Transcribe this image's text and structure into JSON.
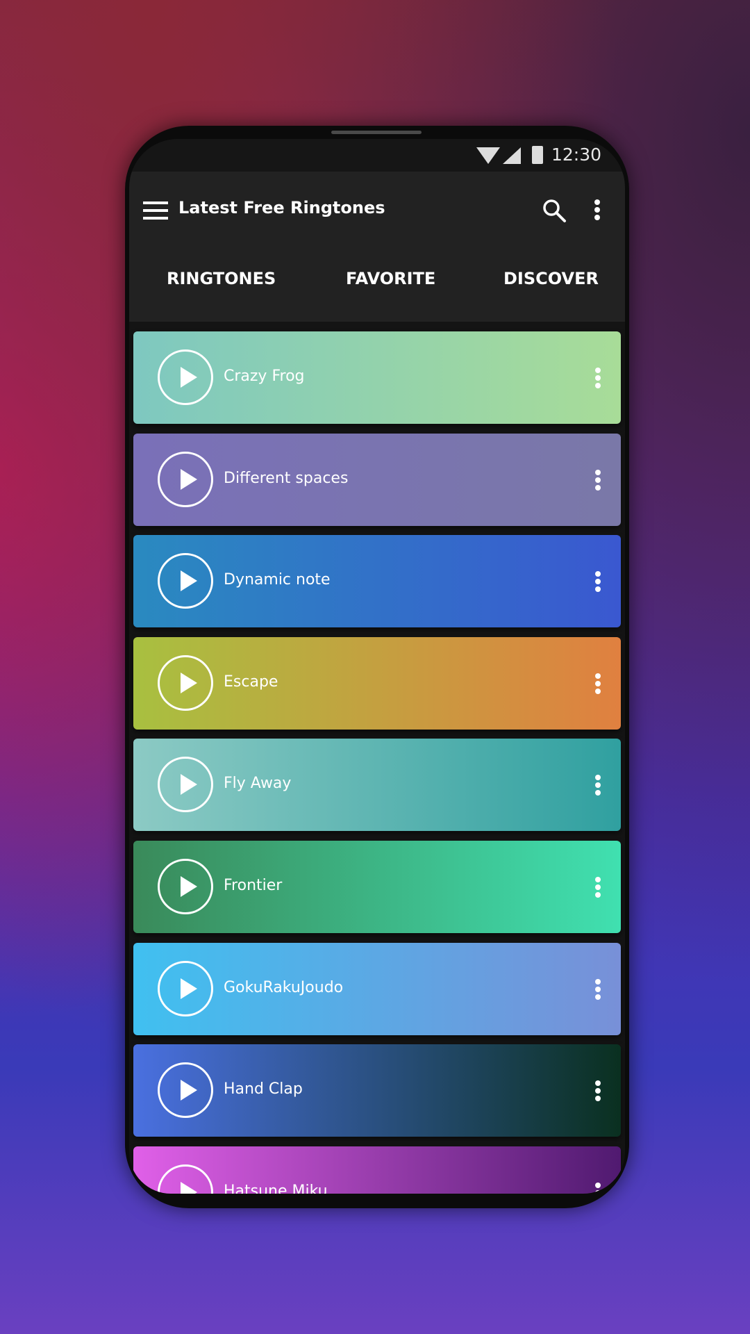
{
  "status": {
    "time": "12:30",
    "icons": [
      "wifi-icon",
      "signal-icon",
      "battery-icon"
    ]
  },
  "appbar": {
    "title": "Latest Free Ringtones",
    "icons": [
      "menu-icon",
      "search-icon",
      "more-vert-icon"
    ]
  },
  "tabs": [
    {
      "label": "RINGTONES"
    },
    {
      "label": "FAVORITE"
    },
    {
      "label": "DISCOVER"
    }
  ],
  "ringtones": [
    {
      "name": "Crazy Frog",
      "colors": [
        "#7ec8c0",
        "#a8dc98"
      ]
    },
    {
      "name": "Different spaces",
      "colors": [
        "#7a70b8",
        "#7a78a8"
      ]
    },
    {
      "name": "Dynamic note",
      "colors": [
        "#2a8ac0",
        "#3a58d0"
      ]
    },
    {
      "name": "Escape",
      "colors": [
        "#a8c040",
        "#e08040"
      ]
    },
    {
      "name": "Fly Away",
      "colors": [
        "#8ccac4",
        "#30a0a0"
      ]
    },
    {
      "name": "Frontier",
      "colors": [
        "#3a8a5a",
        "#40e0b0"
      ]
    },
    {
      "name": "GokuRakuJoudo",
      "colors": [
        "#40c0f0",
        "#7890d8"
      ]
    },
    {
      "name": "Hand Clap",
      "colors": [
        "#4a70e0",
        "#0a3020"
      ]
    },
    {
      "name": "Hatsune Miku",
      "colors": [
        "#e060e8",
        "#501a70"
      ]
    }
  ]
}
